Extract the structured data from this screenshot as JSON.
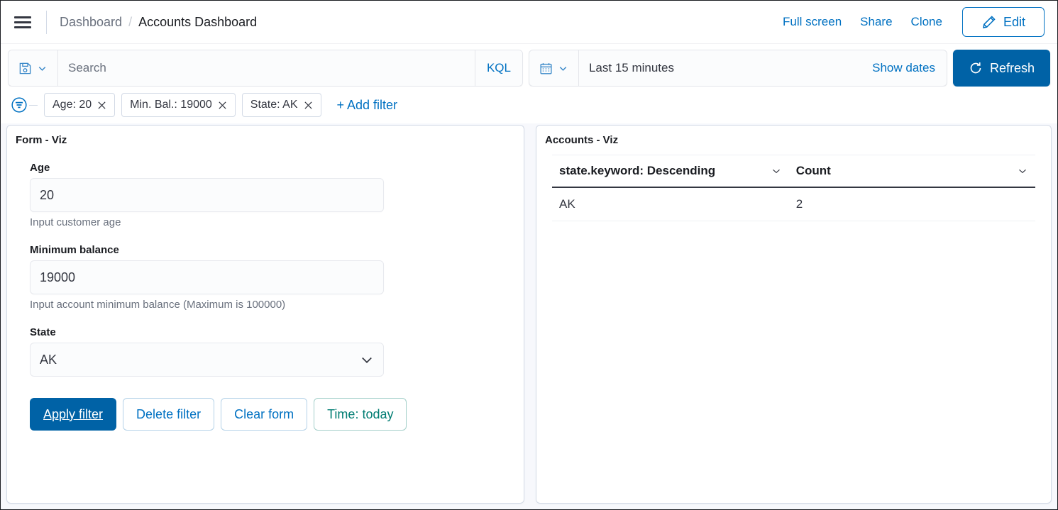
{
  "header": {
    "menu_icon": "hamburger-menu-icon",
    "breadcrumb": {
      "parent": "Dashboard",
      "separator": "/",
      "current": "Accounts Dashboard"
    },
    "actions": {
      "full_screen": "Full screen",
      "share": "Share",
      "clone": "Clone",
      "edit": "Edit",
      "edit_icon": "pencil-icon"
    }
  },
  "query_bar": {
    "save_icon": "save-floppy-icon",
    "save_chevron_icon": "chevron-down-icon",
    "search_value": "",
    "search_placeholder": "Search",
    "language_label": "KQL",
    "calendar_icon": "calendar-icon",
    "date_chevron_icon": "chevron-down-icon",
    "date_range": "Last 15 minutes",
    "show_dates": "Show dates",
    "refresh_label": "Refresh",
    "refresh_icon": "refresh-icon"
  },
  "filter_bar": {
    "filter_icon": "filter-circle-icon",
    "pills": [
      {
        "label": "Age: 20",
        "remove_icon": "close-icon"
      },
      {
        "label": "Min. Bal.: 19000",
        "remove_icon": "close-icon"
      },
      {
        "label": "State: AK",
        "remove_icon": "close-icon"
      }
    ],
    "add_filter": "+ Add filter"
  },
  "panels": {
    "form_panel": {
      "title": "Form - Viz",
      "fields": {
        "age": {
          "label": "Age",
          "value": "20",
          "placeholder": "",
          "help": "Input customer age"
        },
        "min_balance": {
          "label": "Minimum balance",
          "value": "19000",
          "placeholder": "",
          "help": "Input account minimum balance (Maximum is 100000)"
        },
        "state": {
          "label": "State",
          "value": "AK",
          "chevron_icon": "chevron-down-icon"
        }
      },
      "buttons": {
        "apply": "Apply filter",
        "delete": "Delete filter",
        "clear": "Clear form",
        "time": "Time: today"
      }
    },
    "accounts_panel": {
      "title": "Accounts - Viz",
      "table": {
        "columns": [
          {
            "label": "state.keyword: Descending",
            "sort_icon": "chevron-down-icon"
          },
          {
            "label": "Count",
            "sort_icon": "chevron-down-icon"
          }
        ],
        "rows": [
          [
            "AK",
            "2"
          ]
        ]
      }
    }
  },
  "colors": {
    "primary_blue": "#0071c2",
    "primary_blue_dark": "#0062a6",
    "success_green": "#017d73",
    "text_dark": "#1a1c21",
    "text_muted": "#69707d",
    "border": "#d3dae6",
    "panel_bg": "#f7f8fc"
  }
}
